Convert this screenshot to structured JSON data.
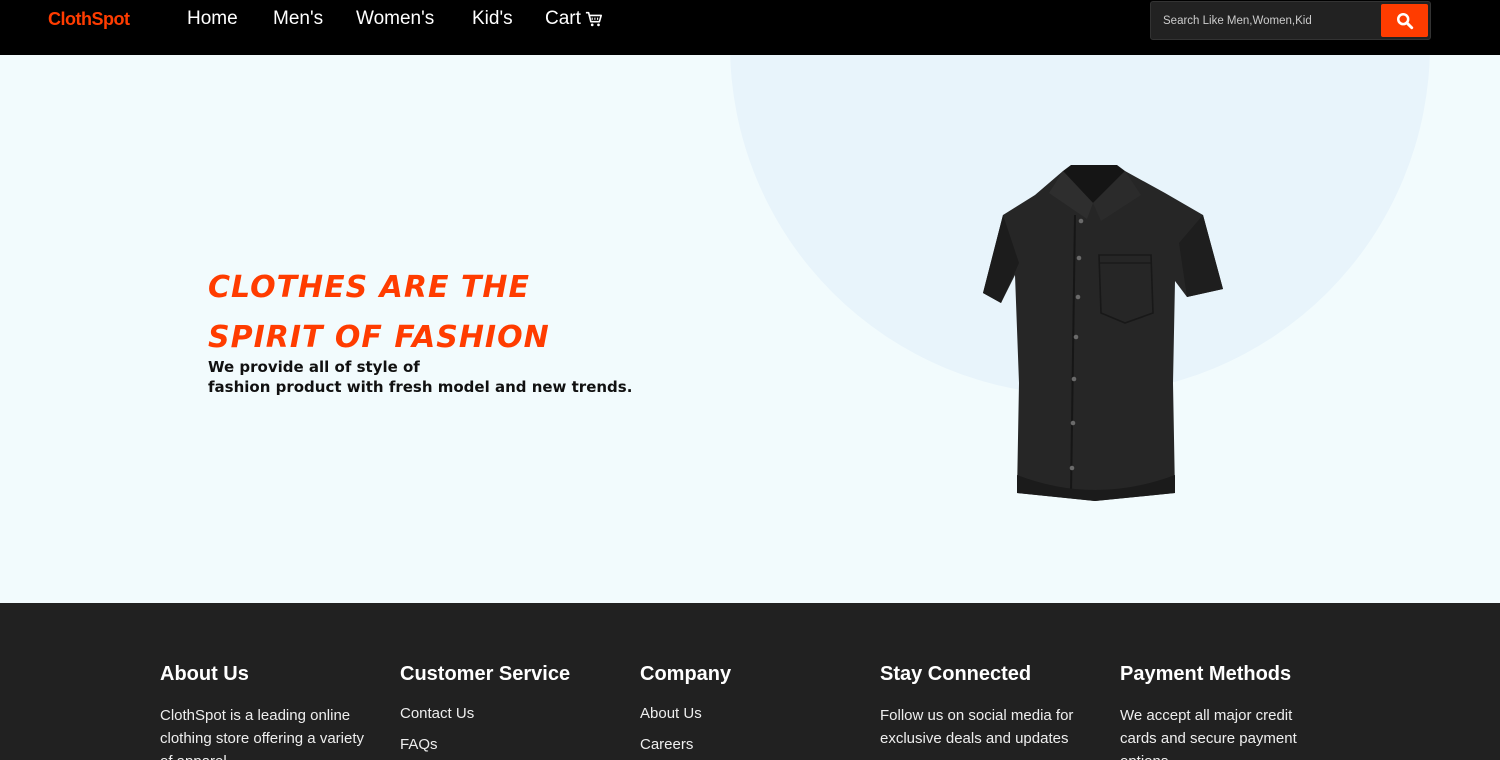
{
  "nav": {
    "brand": "ClothSpot",
    "links": [
      "Home",
      "Men's",
      "Women's",
      "Kid's"
    ],
    "cart_label": "Cart",
    "cart_icon": "cart-icon",
    "search_placeholder": "Search Like Men,Women,Kid",
    "search_icon": "search-icon"
  },
  "hero": {
    "title": "Clothes are the spirit of fashion",
    "subtitle_line1": "We provide all of style of",
    "subtitle_line2": "fashion product with fresh model and new trends.",
    "image": "black-shirt-image"
  },
  "footer": {
    "about": {
      "title": "About Us",
      "text": "ClothSpot is a leading online clothing store offering a variety of apparel"
    },
    "customer_service": {
      "title": "Customer Service",
      "links": [
        "Contact Us",
        "FAQs"
      ]
    },
    "company": {
      "title": "Company",
      "links": [
        "About Us",
        "Careers"
      ]
    },
    "stay_connected": {
      "title": "Stay Connected",
      "text": "Follow us on social media for exclusive deals and updates"
    },
    "payment": {
      "title": "Payment Methods",
      "text": "We accept all major credit cards and secure payment options"
    }
  },
  "colors": {
    "accent": "#ff3c00",
    "nav_bg": "#000000",
    "hero_bg": "#f2fbfd",
    "footer_bg": "#212121"
  }
}
